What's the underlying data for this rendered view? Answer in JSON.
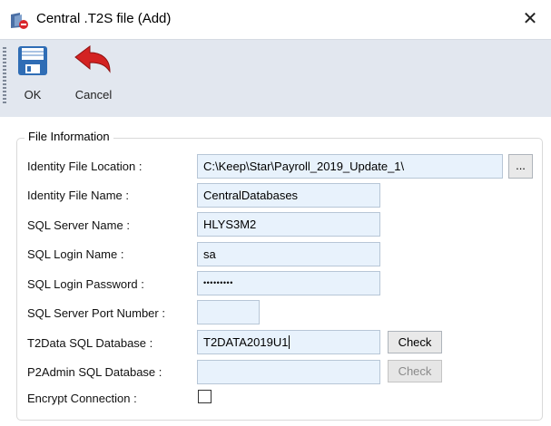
{
  "window": {
    "title": "Central .T2S file (Add)",
    "close_glyph": "✕"
  },
  "toolbar": {
    "ok_label": "OK",
    "ok_icon": "save-disk-icon",
    "cancel_label": "Cancel",
    "cancel_icon": "undo-arrow-icon"
  },
  "group": {
    "legend": "File Information"
  },
  "form": {
    "identity_location": {
      "label": "Identity File Location :",
      "value": "C:\\Keep\\Star\\Payroll_2019_Update_1\\"
    },
    "browse_label": "...",
    "identity_name": {
      "label": "Identity File Name :",
      "value": "CentralDatabases"
    },
    "server_name": {
      "label": "SQL Server Name :",
      "value": "HLYS3M2"
    },
    "login_name": {
      "label": "SQL Login Name :",
      "value": "sa"
    },
    "login_password": {
      "label": "SQL Login Password :",
      "value": "•••••••••"
    },
    "port": {
      "label": "SQL Server Port Number :",
      "value": ""
    },
    "t2data_db": {
      "label": "T2Data SQL Database :",
      "value": "T2DATA2019U1"
    },
    "p2admin_db": {
      "label": "P2Admin SQL Database :",
      "value": ""
    },
    "check_label": "Check",
    "encrypt": {
      "label": "Encrypt Connection :",
      "checked": false
    }
  },
  "colors": {
    "toolbar_bg": "#e2e7ef",
    "field_bg": "#e8f2fc",
    "cancel_arrow": "#d32222"
  }
}
